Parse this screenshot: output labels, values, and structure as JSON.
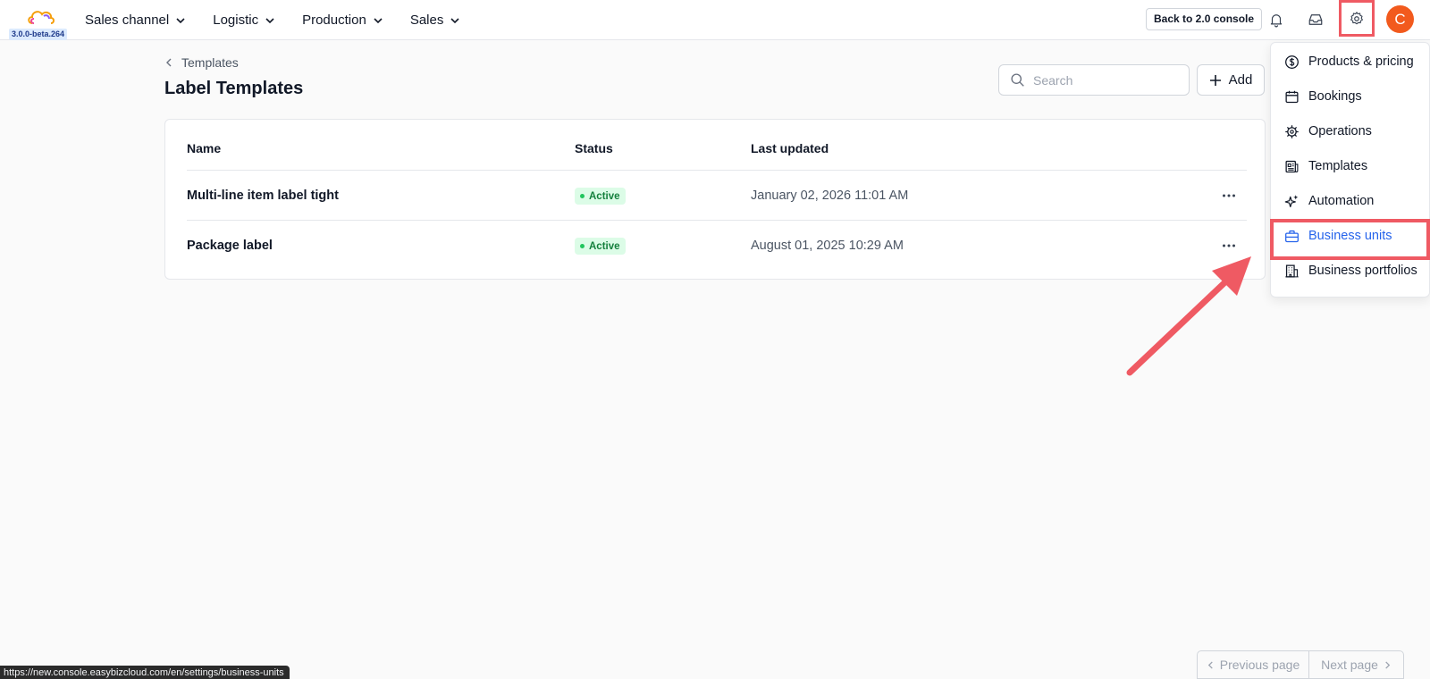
{
  "header": {
    "version": "3.0.0-beta.264",
    "nav": [
      {
        "label": "Sales channel"
      },
      {
        "label": "Logistic"
      },
      {
        "label": "Production"
      },
      {
        "label": "Sales"
      }
    ],
    "back_console_label": "Back to 2.0 console",
    "avatar_initial": "C"
  },
  "page": {
    "breadcrumb": "Templates",
    "title": "Label Templates",
    "search_placeholder": "Search",
    "add_label": "Add"
  },
  "table": {
    "columns": [
      "Name",
      "Status",
      "Last updated"
    ],
    "rows": [
      {
        "name": "Multi-line item label tight",
        "status": "Active",
        "updated": "January 02, 2026 11:01 AM"
      },
      {
        "name": "Package label",
        "status": "Active",
        "updated": "August 01, 2025 10:29 AM"
      }
    ]
  },
  "settings_menu": {
    "items": [
      {
        "label": "Products & pricing",
        "icon": "dollar-circle-icon"
      },
      {
        "label": "Bookings",
        "icon": "calendar-icon"
      },
      {
        "label": "Operations",
        "icon": "cog-icon"
      },
      {
        "label": "Templates",
        "icon": "newspaper-icon"
      },
      {
        "label": "Automation",
        "icon": "sparkles-icon"
      },
      {
        "label": "Business units",
        "icon": "briefcase-icon",
        "active": true
      },
      {
        "label": "Business portfolios",
        "icon": "building-icon"
      }
    ]
  },
  "pagination": {
    "prev_label": "Previous page",
    "next_label": "Next page"
  },
  "status_bar": {
    "url": "https://new.console.easybizcloud.com/en/settings/business-units"
  },
  "colors": {
    "accent": "#2563eb",
    "annotation": "#ef5a63",
    "avatar": "#f25a1d",
    "status_active_bg": "#dcfce7",
    "status_active_text": "#15803d"
  }
}
